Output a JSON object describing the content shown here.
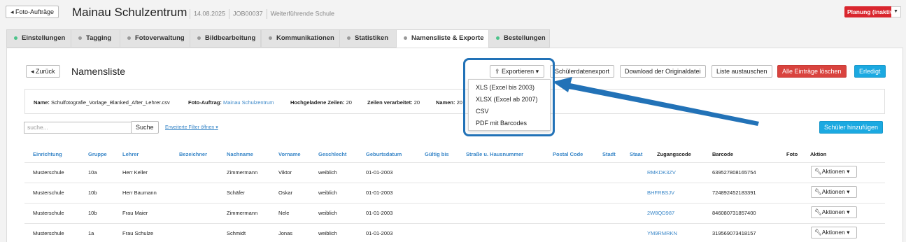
{
  "header": {
    "back_label": "◂ Foto-Aufträge",
    "title": "Mainau Schulzentrum",
    "date": "14.08.2025",
    "job": "JOB00037",
    "school_type": "Weiterführende Schule",
    "status": "Planung (inaktiv)"
  },
  "tabs": [
    {
      "label": "Einstellungen",
      "dot_color": "#4cc38a"
    },
    {
      "label": "Tagging",
      "dot_color": "#999999"
    },
    {
      "label": "Fotoverwaltung",
      "dot_color": "#999999"
    },
    {
      "label": "Bildbearbeitung",
      "dot_color": "#999999"
    },
    {
      "label": "Kommunikationen",
      "dot_color": "#999999"
    },
    {
      "label": "Statistiken",
      "dot_color": "#999999"
    },
    {
      "label": "Namensliste & Exporte",
      "dot_color": "#999999"
    },
    {
      "label": "Bestellungen",
      "dot_color": "#4cc38a"
    }
  ],
  "toolbar": {
    "back_label": "◂ Zurück",
    "title": "Namensliste",
    "export_label": "Exportieren",
    "schuelerdaten_label": "Schülerdatenexport",
    "download_label": "Download der Originaldatei",
    "replace_label": "Liste austauschen",
    "delete_label": "Alle Einträge löschen",
    "done_label": "Erledigt"
  },
  "export_menu": [
    "XLS (Excel bis 2003)",
    "XLSX (Excel ab 2007)",
    "CSV",
    "PDF mit Barcodes"
  ],
  "info": {
    "name_label": "Name:",
    "name_value": "Schulfotografie_Vorlage_Blanked_After_Lehrer.csv",
    "order_label": "Foto-Auftrag:",
    "order_value": "Mainau Schulzentrum",
    "uploaded_label": "Hochgeladene Zeilen:",
    "uploaded_value": "20",
    "processed_label": "Zeilen verarbeitet:",
    "processed_value": "20",
    "names_label": "Namen:",
    "names_value": "20"
  },
  "search": {
    "placeholder": "suche...",
    "button_label": "Suche",
    "filter_link": "Erweiterte Filter öffnen",
    "add_label": "Schüler hinzufügen"
  },
  "columns": [
    "Einrichtung",
    "Gruppe",
    "Lehrer",
    "Bezeichner",
    "Nachname",
    "Vorname",
    "Geschlecht",
    "Geburtsdatum",
    "Gültig bis",
    "Straße u. Hausnummer",
    "Postal Code",
    "Stadt",
    "Staat",
    "Zugangscode",
    "Barcode",
    "Foto",
    "Aktion"
  ],
  "rows": [
    {
      "einrichtung": "Musterschule",
      "gruppe": "10a",
      "lehrer": "Herr Keller",
      "nachname": "Zimmermann",
      "vorname": "Viktor",
      "geschlecht": "weiblich",
      "geburtsdatum": "01-01-2003",
      "code": "RMKDK3ZV",
      "barcode": "639527808165754",
      "action": "Aktionen"
    },
    {
      "einrichtung": "Musterschule",
      "gruppe": "10b",
      "lehrer": "Herr Baumann",
      "nachname": "Schäfer",
      "vorname": "Oskar",
      "geschlecht": "weiblich",
      "geburtsdatum": "01-01-2003",
      "code": "BHFRBSJV",
      "barcode": "724892452183391",
      "action": "Aktionen"
    },
    {
      "einrichtung": "Musterschule",
      "gruppe": "10b",
      "lehrer": "Frau Maier",
      "nachname": "Zimmermann",
      "vorname": "Nele",
      "geschlecht": "weiblich",
      "geburtsdatum": "01-01-2003",
      "code": "2W8QD987",
      "barcode": "846080731857400",
      "action": "Aktionen"
    },
    {
      "einrichtung": "Musterschule",
      "gruppe": "1a",
      "lehrer": "Frau Schulze",
      "nachname": "Schmidt",
      "vorname": "Jonas",
      "geschlecht": "weiblich",
      "geburtsdatum": "01-01-2003",
      "code": "YM9RMRKN",
      "barcode": "319569073418157",
      "action": "Aktionen"
    }
  ]
}
